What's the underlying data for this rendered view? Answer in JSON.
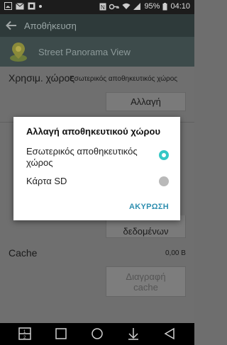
{
  "status_bar": {
    "battery": "95%",
    "time": "04:10"
  },
  "app_bar": {
    "back_icon": "arrow-left-icon",
    "title": "Αποθήκευση"
  },
  "app_header": {
    "logo_icon": "street-panorama-logo",
    "name": "Street Panorama View"
  },
  "content": {
    "storage_used_label": "Χρησιμ. χώρος",
    "storage_used_value": "Εσωτερικός αποθηκευτικός χώρος",
    "change_button": "Αλλαγή",
    "clear_data_button_line": "δεδομένων",
    "cache_label": "Cache",
    "cache_value": "0,00 B",
    "clear_cache_line1": "Διαγραφή",
    "clear_cache_line2": "cache"
  },
  "dialog": {
    "title": "Αλλαγή αποθηκευτικού χώρου",
    "options": [
      {
        "label": "Εσωτερικός αποθηκευτικός χώρος",
        "selected": true
      },
      {
        "label": "Κάρτα SD",
        "selected": false
      }
    ],
    "cancel": "ΑΚΥΡΩΣΗ",
    "accent": "#35c7c5"
  },
  "nav_bar": {
    "icons": [
      "dual-window-icon",
      "recents-icon",
      "home-icon",
      "notifications-down-icon",
      "back-icon"
    ]
  }
}
